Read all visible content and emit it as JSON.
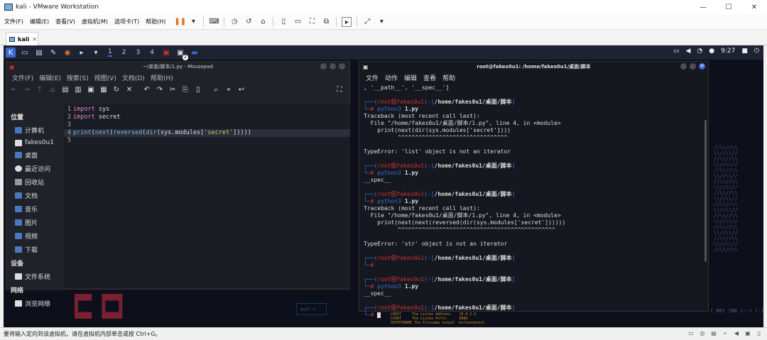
{
  "window": {
    "title": "kali - VMware Workstation",
    "min": "—",
    "max": "☐",
    "close": "✕"
  },
  "menu": [
    "文件(F)",
    "编辑(E)",
    "查看(V)",
    "虚拟机(M)",
    "选项卡(T)",
    "帮助(H)"
  ],
  "vm_tab": "kali",
  "panel": {
    "workspaces": [
      "1",
      "2",
      "3",
      "4"
    ],
    "badge": "2",
    "time": "9:27"
  },
  "mousepad": {
    "title": "~/桌面/脚本/1.py - Mousepad",
    "menu": [
      "文件(F)",
      "编辑(E)",
      "搜索(S)",
      "视图(V)",
      "文档(D)",
      "帮助(H)"
    ],
    "sidebar": {
      "places_header": "位置",
      "places": [
        "计算机",
        "fakes0u1",
        "桌面",
        "最近访问",
        "回收站",
        "文档",
        "音乐",
        "图片",
        "视频",
        "下载"
      ],
      "devices_header": "设备",
      "devices": [
        "文件系统"
      ],
      "network_header": "网络",
      "network": [
        "浏览网络"
      ]
    },
    "lines": [
      {
        "n": "1",
        "parts": [
          [
            "kw",
            "import"
          ],
          [
            "",
            "  sys"
          ]
        ]
      },
      {
        "n": "2",
        "parts": [
          [
            "kw",
            "import"
          ],
          [
            "",
            "  secret"
          ]
        ]
      },
      {
        "n": "3",
        "parts": []
      },
      {
        "n": "4",
        "parts": [
          [
            "fn",
            "print"
          ],
          [
            "",
            "("
          ],
          [
            "fn",
            "next"
          ],
          [
            "",
            "("
          ],
          [
            "fn",
            "reversed"
          ],
          [
            "",
            "("
          ],
          [
            "fn",
            "dir"
          ],
          [
            "",
            "(sys.modules["
          ],
          [
            "str",
            "'secret'"
          ],
          [
            "",
            "])))"
          ],
          [
            "",
            ")"
          ]
        ]
      },
      {
        "n": "5",
        "parts": []
      }
    ]
  },
  "terminal": {
    "title": "root@fakes0u1: /home/fakes0u1/桌面/脚本",
    "menu": [
      "文件",
      "动作",
      "编辑",
      "查看",
      "帮助"
    ],
    "prompt_user": "root㉿fakes0u1",
    "prompt_path": "/home/fakes0u1/桌面/脚本",
    "head": ", '__path__', '__spec__']",
    "cmd": "python3",
    "arg": "1.py",
    "blocks": [
      {
        "cmd": true,
        "out": [
          "Traceback (most recent call last):",
          "  File \"/home/fakes0u1/桌面/脚本/1.py\", line 4, in <module>",
          "    print(next(dir(sys.modules['secret'])))",
          "          ^^^^^^^^^^^^^^^^^^^^^^^^^^^^^^^^",
          "",
          "TypeError: 'list' object is not an iterator"
        ]
      },
      {
        "cmd": true,
        "out": [
          "__spec__"
        ]
      },
      {
        "cmd": true,
        "out": [
          "Traceback (most recent call last):",
          "  File \"/home/fakes0u1/桌面/脚本/1.py\", line 4, in <module>",
          "    print(next(next(reversed(dir(sys.modules['secret'])))))",
          "          ^^^^^^^^^^^^^^^^^^^^^^^^^^^^^^^^^^^^^^^^^^^^^^",
          "",
          "TypeError: 'str' object is not an iterator"
        ]
      },
      {
        "cmd": false,
        "out": []
      },
      {
        "cmd": true,
        "out": [
          "__spec__"
        ]
      },
      {
        "cmd": false,
        "cursor": true,
        "out": []
      }
    ]
  },
  "status": "要将输入定向到该虚拟机，请在虚拟机内部单击或按 Ctrl+G。",
  "colors": {
    "accent": "#3a6ad8",
    "prompt_red": "#d03030"
  }
}
